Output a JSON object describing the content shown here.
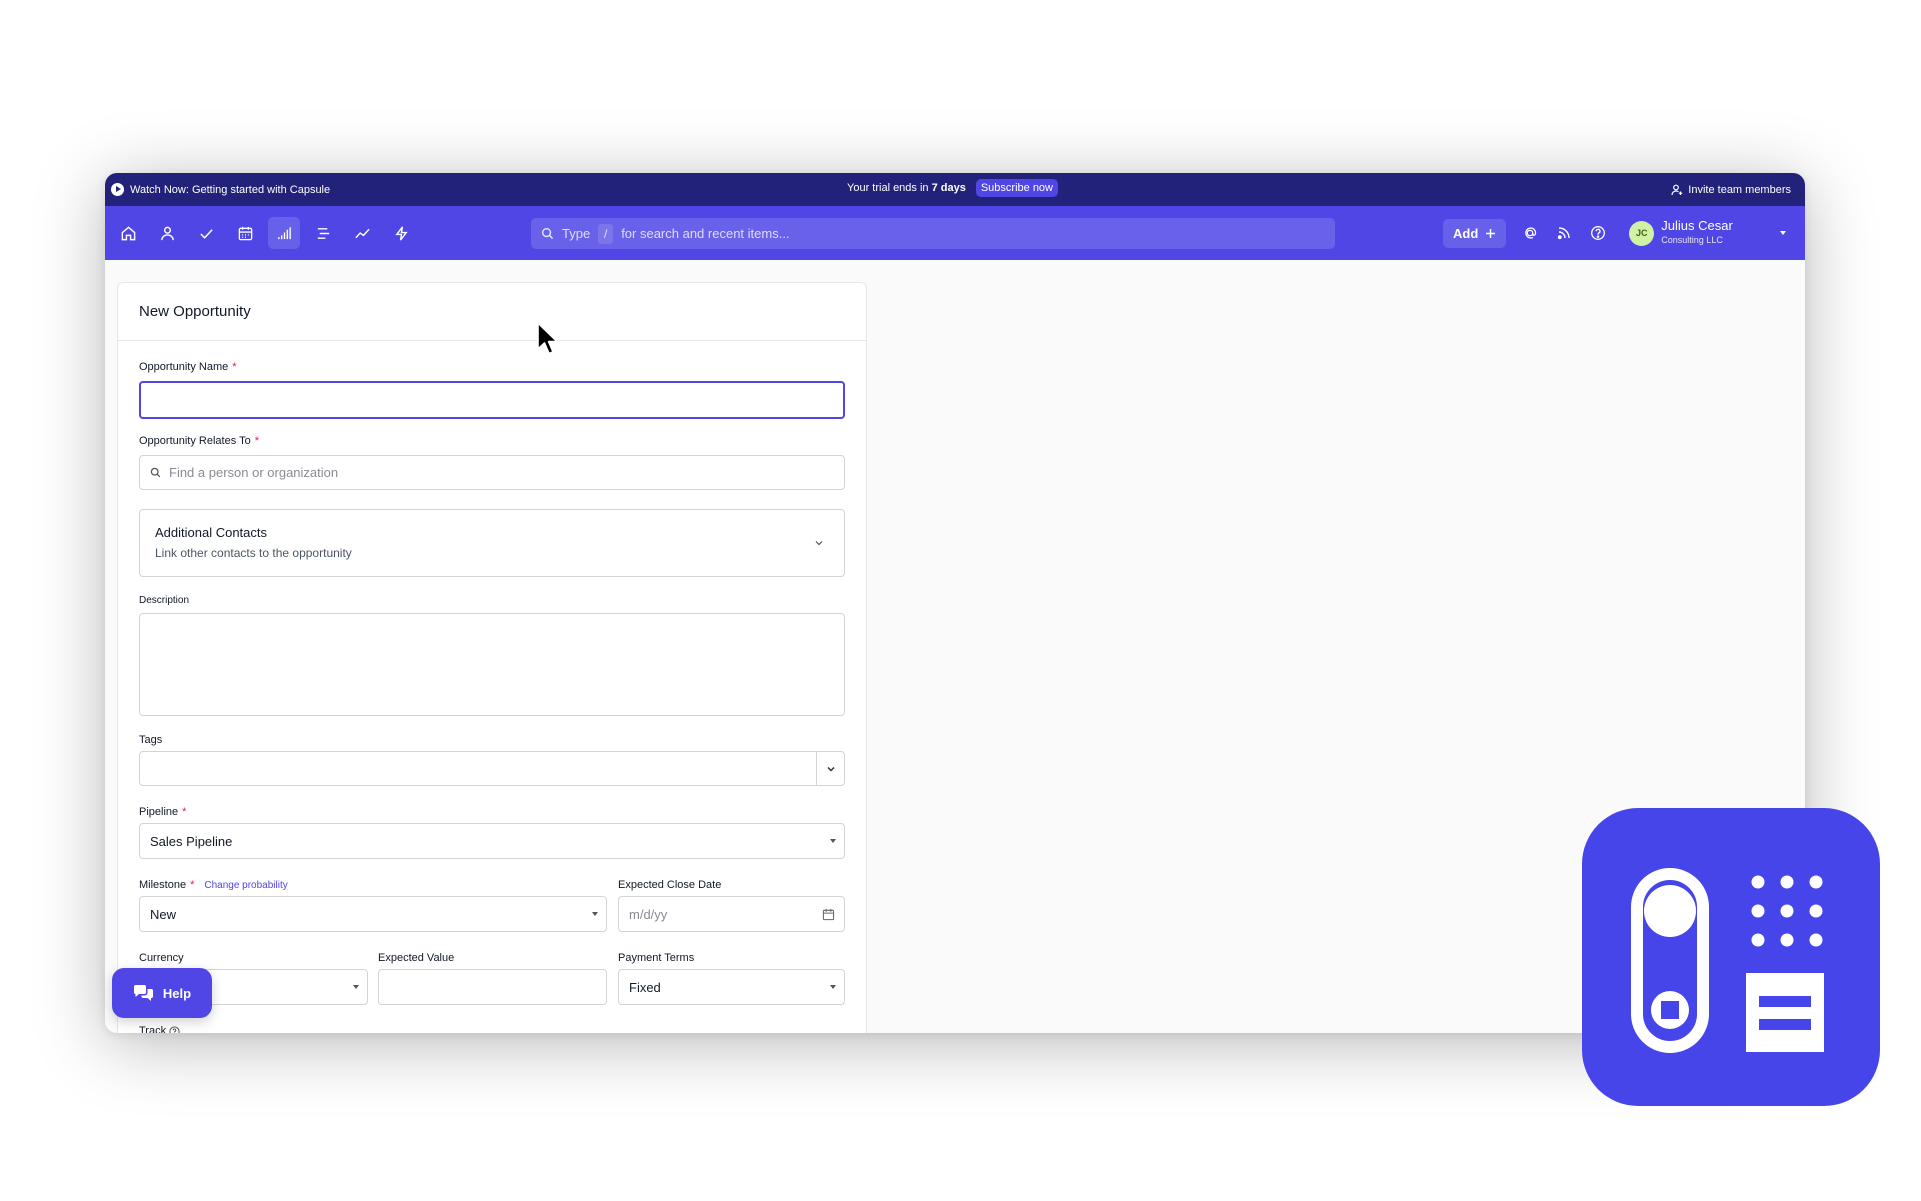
{
  "banner": {
    "watch_text": "Watch Now: Getting started with Capsule",
    "trial_prefix": "Your trial ends in ",
    "trial_days": "7 days",
    "subscribe_label": "Subscribe now",
    "invite_label": "Invite team members"
  },
  "nav": {
    "icons": [
      "home-icon",
      "person-icon",
      "check-icon",
      "calendar-icon",
      "pipeline-icon",
      "list-icon",
      "trend-icon",
      "lightning-icon"
    ],
    "active_icon": "pipeline-icon",
    "search": {
      "type_text": "Type",
      "key": "/",
      "hint": "for search and recent items..."
    },
    "add_label": "Add",
    "user": {
      "initials": "JC",
      "name": "Julius Cesar",
      "company": "Consulting LLC"
    }
  },
  "form": {
    "title": "New Opportunity",
    "opportunity_name": {
      "label": "Opportunity Name",
      "value": ""
    },
    "relates_to": {
      "label": "Opportunity Relates To",
      "placeholder": "Find a person or organization"
    },
    "additional_contacts": {
      "title": "Additional Contacts",
      "subtitle": "Link other contacts to the opportunity"
    },
    "description": {
      "label": "Description",
      "value": ""
    },
    "tags": {
      "label": "Tags",
      "value": ""
    },
    "pipeline": {
      "label": "Pipeline",
      "value": "Sales Pipeline"
    },
    "milestone": {
      "label": "Milestone",
      "value": "New",
      "link": "Change probability"
    },
    "close_date": {
      "label": "Expected Close Date",
      "placeholder": "m/d/yy"
    },
    "currency": {
      "label": "Currency",
      "value": ""
    },
    "expected_value": {
      "label": "Expected Value",
      "value": ""
    },
    "payment_terms": {
      "label": "Payment Terms",
      "value": "Fixed"
    },
    "track": {
      "label": "Track"
    }
  },
  "help": {
    "label": "Help"
  },
  "colors": {
    "brand": "#4f46e5",
    "banner": "#22227a",
    "logo_tile": "#4545ea",
    "required": "#e11d48"
  }
}
